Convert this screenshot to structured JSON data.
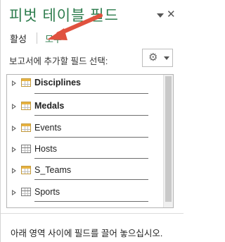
{
  "pane": {
    "title": "피벗 테이블 필드",
    "tabs": {
      "active": "활성",
      "all": "모두"
    },
    "prompt": "보고서에 추가할 필드 선택:",
    "fields": [
      {
        "label": "Disciplines",
        "bold": true,
        "highlight": true
      },
      {
        "label": "Medals",
        "bold": true,
        "highlight": true
      },
      {
        "label": "Events",
        "bold": false,
        "highlight": true
      },
      {
        "label": "Hosts",
        "bold": false,
        "highlight": false
      },
      {
        "label": "S_Teams",
        "bold": false,
        "highlight": true
      },
      {
        "label": "Sports",
        "bold": false,
        "highlight": false
      }
    ],
    "footer": "아래 영역 사이에 필드를 끌어 놓으십시오."
  },
  "icons": {
    "dropdown": "chevron-down-icon",
    "close": "close-icon",
    "settings": "gear-icon",
    "expand": "expand-triangle-icon",
    "table": "table-icon",
    "annotation": "red-arrow-annotation"
  },
  "colors": {
    "title": "#2e7d4e",
    "all_tab": "#2e7d4e",
    "arrow": "#e0523f",
    "table_highlight": "#e8b341"
  }
}
